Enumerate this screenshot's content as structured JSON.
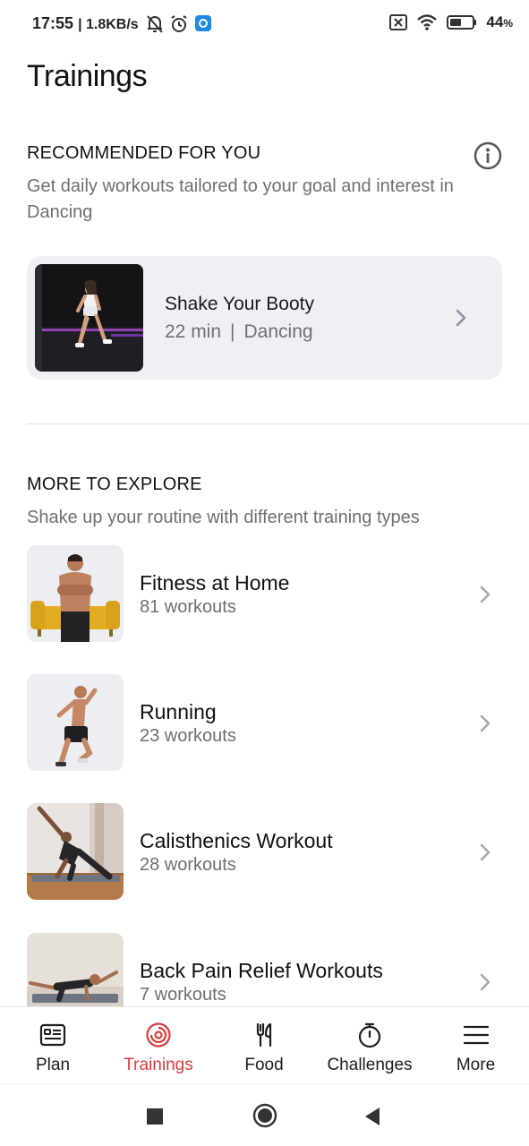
{
  "status_bar": {
    "time": "17:55",
    "speed": "| 1.8KB/s",
    "battery": "44",
    "battery_unit": "%"
  },
  "page_title": "Trainings",
  "recommended": {
    "heading": "RECOMMENDED FOR YOU",
    "subtitle": "Get daily workouts tailored to your goal and interest in Dancing",
    "card": {
      "title": "Shake Your Booty",
      "duration": "22 min",
      "separator": "|",
      "category": "Dancing"
    }
  },
  "explore": {
    "heading": "MORE TO EXPLORE",
    "subtitle": "Shake up your routine with different training types",
    "items": [
      {
        "title": "Fitness at Home",
        "count": "81 workouts"
      },
      {
        "title": "Running",
        "count": "23 workouts"
      },
      {
        "title": "Calisthenics Workout",
        "count": "28 workouts"
      },
      {
        "title": "Back Pain Relief Workouts",
        "count": "7 workouts"
      }
    ]
  },
  "bottom_nav": {
    "active": "Trainings",
    "items": [
      {
        "label": "Plan",
        "icon": "plan-icon"
      },
      {
        "label": "Trainings",
        "icon": "trainings-icon"
      },
      {
        "label": "Food",
        "icon": "fork-knife-icon"
      },
      {
        "label": "Challenges",
        "icon": "stopwatch-icon"
      },
      {
        "label": "More",
        "icon": "menu-icon"
      }
    ]
  },
  "colors": {
    "accent": "#d93a3a",
    "card_bg": "#eef0f4",
    "muted_text": "#6f6f73"
  }
}
